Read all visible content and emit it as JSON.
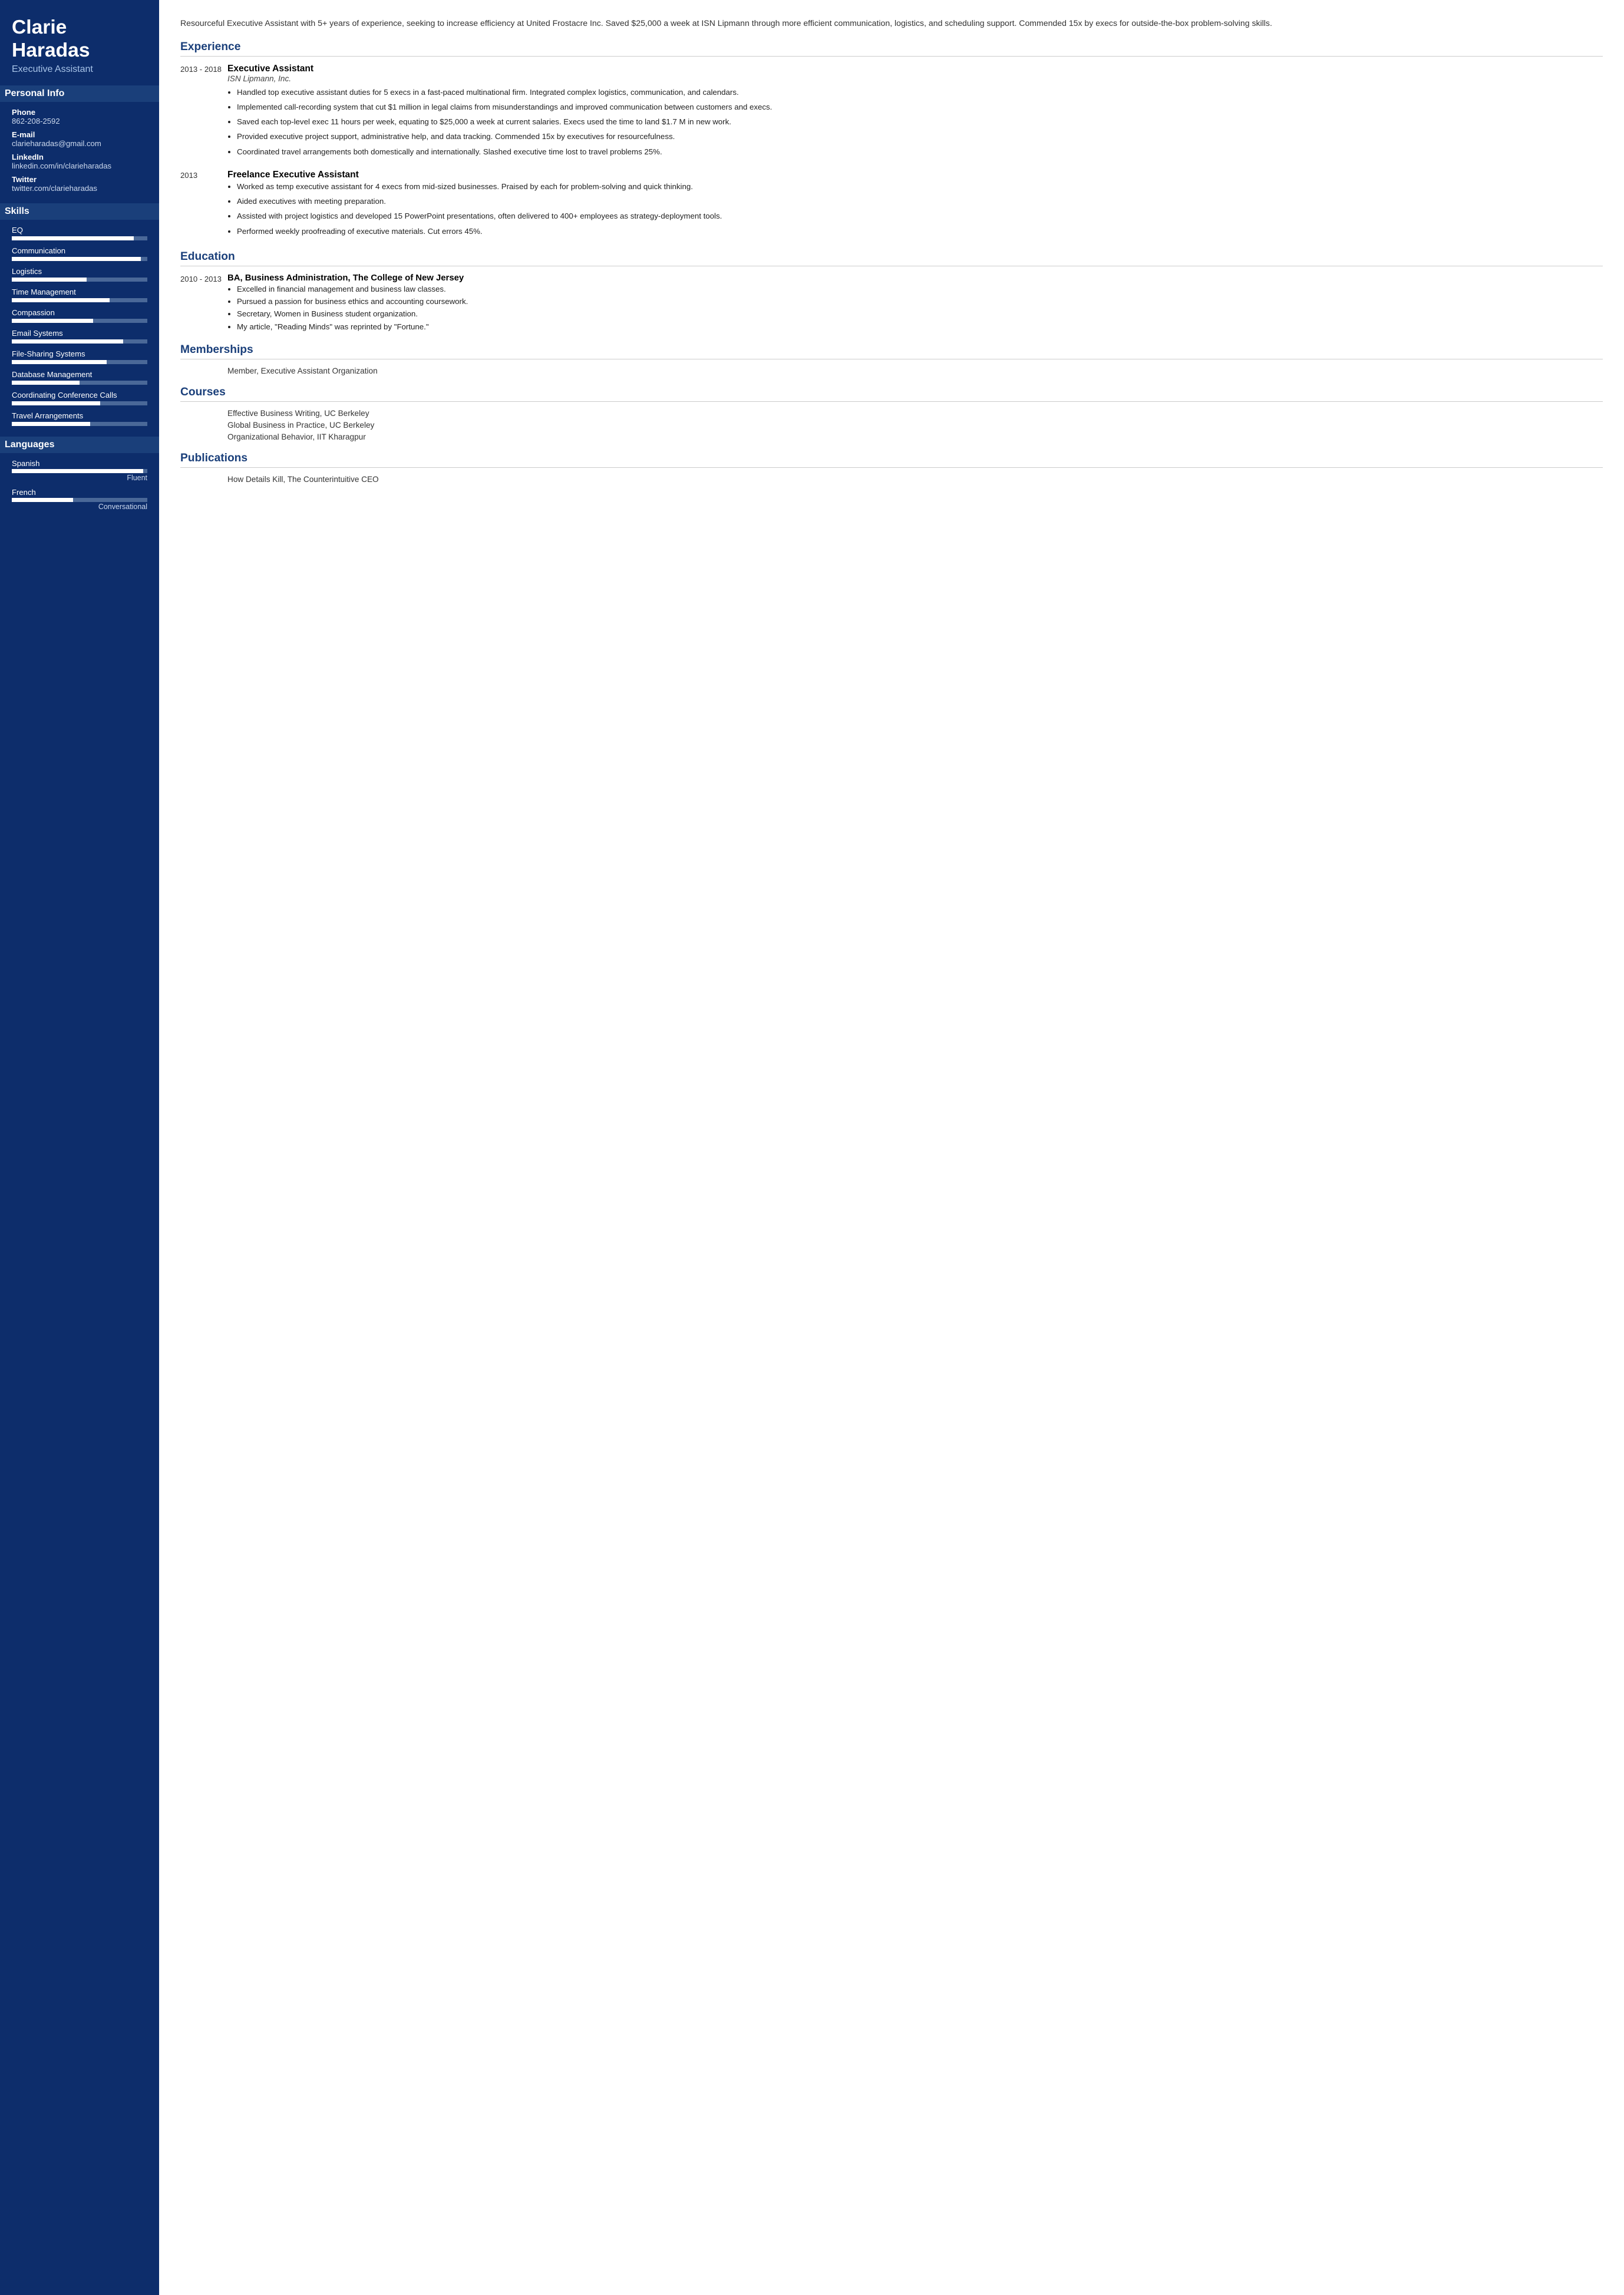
{
  "sidebar": {
    "name": "Clarie Haradas",
    "title": "Executive Assistant",
    "personal_info_label": "Personal Info",
    "phone_label": "Phone",
    "phone": "862-208-2592",
    "email_label": "E-mail",
    "email": "clarieharadas@gmail.com",
    "linkedin_label": "LinkedIn",
    "linkedin": "linkedin.com/in/clarieharadas",
    "twitter_label": "Twitter",
    "twitter": "twitter.com/clarieharadas",
    "skills_label": "Skills",
    "skills": [
      {
        "name": "EQ",
        "fill": 90
      },
      {
        "name": "Communication",
        "fill": 95
      },
      {
        "name": "Logistics",
        "fill": 55
      },
      {
        "name": "Time Management",
        "fill": 72
      },
      {
        "name": "Compassion",
        "fill": 60
      },
      {
        "name": "Email Systems",
        "fill": 82
      },
      {
        "name": "File-Sharing Systems",
        "fill": 70
      },
      {
        "name": "Database Management",
        "fill": 50
      },
      {
        "name": "Coordinating Conference Calls",
        "fill": 65
      },
      {
        "name": "Travel Arrangements",
        "fill": 58
      }
    ],
    "languages_label": "Languages",
    "languages": [
      {
        "name": "Spanish",
        "fill": 97,
        "level": "Fluent"
      },
      {
        "name": "French",
        "fill": 45,
        "level": "Conversational"
      }
    ]
  },
  "main": {
    "summary": "Resourceful Executive Assistant with 5+ years of experience, seeking to increase efficiency at United Frostacre Inc. Saved $25,000 a week at ISN Lipmann through more efficient communication, logistics, and scheduling support. Commended 15x by execs for outside-the-box problem-solving skills.",
    "experience_label": "Experience",
    "experience": [
      {
        "date": "2013 - 2018",
        "title": "Executive Assistant",
        "company": "ISN Lipmann, Inc.",
        "bullets": [
          "Handled top executive assistant duties for 5 execs in a fast-paced multinational firm. Integrated complex logistics, communication, and calendars.",
          "Implemented call-recording system that cut $1 million in legal claims from misunderstandings and improved communication between customers and execs.",
          "Saved each top-level exec 11 hours per week, equating to $25,000 a week at current salaries. Execs used the time to land $1.7 M in new work.",
          "Provided executive project support, administrative help, and data tracking. Commended 15x by executives for resourcefulness.",
          "Coordinated travel arrangements both domestically and internationally. Slashed executive time lost to travel problems 25%."
        ]
      },
      {
        "date": "2013",
        "title": "Freelance Executive Assistant",
        "company": "",
        "bullets": [
          "Worked as temp executive assistant for 4 execs from mid-sized businesses. Praised by each for problem-solving and quick thinking.",
          "Aided executives with meeting preparation.",
          "Assisted with project logistics and developed 15 PowerPoint presentations, often delivered to 400+ employees as strategy-deployment tools.",
          "Performed weekly proofreading of executive materials. Cut errors 45%."
        ]
      }
    ],
    "education_label": "Education",
    "education": [
      {
        "date": "2010 - 2013",
        "degree": "BA, Business Administration, The College of New Jersey",
        "bullets": [
          "Excelled in financial management and business law classes.",
          "Pursued a passion for business ethics and accounting coursework.",
          "Secretary, Women in Business student organization.",
          "My article, \"Reading Minds\" was reprinted by \"Fortune.\""
        ]
      }
    ],
    "memberships_label": "Memberships",
    "memberships": [
      "Member, Executive Assistant Organization"
    ],
    "courses_label": "Courses",
    "courses": [
      "Effective Business Writing, UC Berkeley",
      "Global Business in Practice, UC Berkeley",
      "Organizational Behavior, IIT Kharagpur"
    ],
    "publications_label": "Publications",
    "publications": [
      "How Details Kill, The Counterintuitive CEO"
    ]
  }
}
